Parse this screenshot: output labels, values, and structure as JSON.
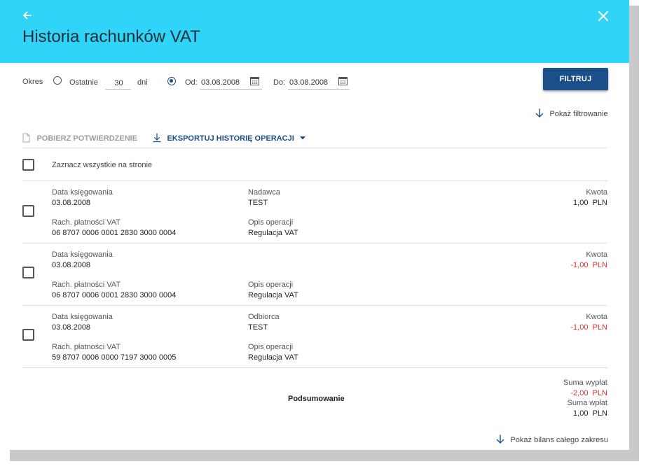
{
  "header": {
    "title": "Historia rachunków VAT"
  },
  "filter": {
    "period_label": "Okres",
    "last_label": "Ostatnie",
    "last_days_value": "30",
    "days_label": "dni",
    "from_label": "Od:",
    "from_value": "03.08.2008",
    "to_label": "Do:",
    "to_value": "03.08.2008",
    "filter_button": "FILTRUJ",
    "show_filter_link": "Pokaż filtrowanie",
    "selected_option": "od-do"
  },
  "toolbar": {
    "download_confirmation": "POBIERZ POTWIERDZENIE",
    "export_history": "EKSPORTUJ HISTORIĘ OPERACJI"
  },
  "select_all_label": "Zaznacz wszystkie na stronie",
  "transactions": [
    {
      "date_label": "Data księgowania",
      "date": "03.08.2008",
      "party_label": "Nadawca",
      "party": "TEST",
      "amount_label": "Kwota",
      "amount": "1,00",
      "currency": "PLN",
      "account_label": "Rach. płatności VAT",
      "account": "06 8707 0006 0001 2830 3000 0004",
      "desc_label": "Opis operacji",
      "desc": "Regulacja VAT"
    },
    {
      "date_label": "Data księgowania",
      "date": "03.08.2008",
      "party_label": "",
      "party": "",
      "amount_label": "Kwota",
      "amount": "-1,00",
      "currency": "PLN",
      "account_label": "Rach. płatności VAT",
      "account": "06 8707 0006 0001 2830 3000 0004",
      "desc_label": "Opis operacji",
      "desc": "Regulacja VAT"
    },
    {
      "date_label": "Data księgowania",
      "date": "03.08.2008",
      "party_label": "Odbiorca",
      "party": "TEST",
      "amount_label": "Kwota",
      "amount": "-1,00",
      "currency": "PLN",
      "account_label": "Rach. płatności VAT",
      "account": "59 8707 0006 0000 7197 3000 0005",
      "desc_label": "Opis operacji",
      "desc": "Regulacja VAT"
    }
  ],
  "summary": {
    "label": "Podsumowanie",
    "withdrawals_label": "Suma wypłat",
    "withdrawals_value": "-2,00",
    "deposits_label": "Suma wpłat",
    "deposits_value": "1,00",
    "currency": "PLN",
    "show_balance_link": "Pokaż bilans całego zakresu"
  },
  "colors": {
    "header_bg": "#30d4f8",
    "primary": "#1a4f8a",
    "negative": "#e0312d"
  }
}
